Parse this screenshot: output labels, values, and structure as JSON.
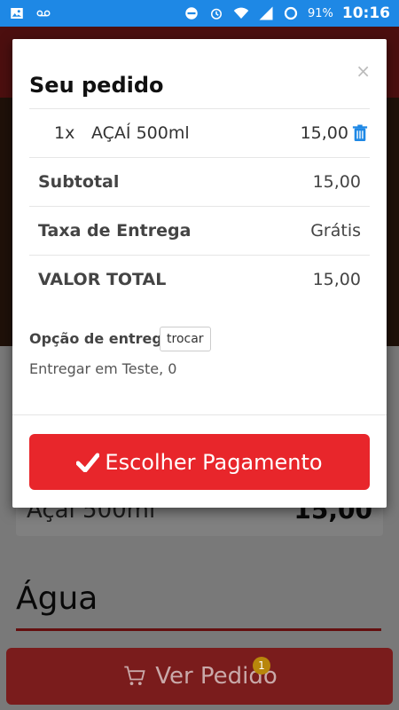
{
  "status_bar": {
    "battery": "91%",
    "time": "10:16",
    "icons": [
      "image-icon",
      "voicemail-icon",
      "dnd-icon",
      "alarm-icon",
      "wifi-icon",
      "signal-icon",
      "battery-icon"
    ]
  },
  "background": {
    "item_name": "Açaí 500ml",
    "item_price": "15,00",
    "section_title": "Água",
    "bottom_button_label": "Ver Pedido",
    "badge_count": "1"
  },
  "modal": {
    "title": "Seu pedido",
    "close_label": "×",
    "item": {
      "qty": "1x",
      "name": "AÇAÍ 500ml",
      "price": "15,00"
    },
    "subtotal_label": "Subtotal",
    "subtotal_value": "15,00",
    "delivery_fee_label": "Taxa de Entrega",
    "delivery_fee_value": "Grátis",
    "total_label": "VALOR TOTAL",
    "total_value": "15,00",
    "delivery_option_label": "Opção de entrega",
    "change_button_label": "trocar",
    "delivery_address": "Entregar em Teste, 0",
    "pay_button_label": "Escolher Pagamento"
  },
  "colors": {
    "accent": "#e8262b",
    "status_bar": "#1e88e5",
    "trash_icon": "#1e88e5"
  }
}
